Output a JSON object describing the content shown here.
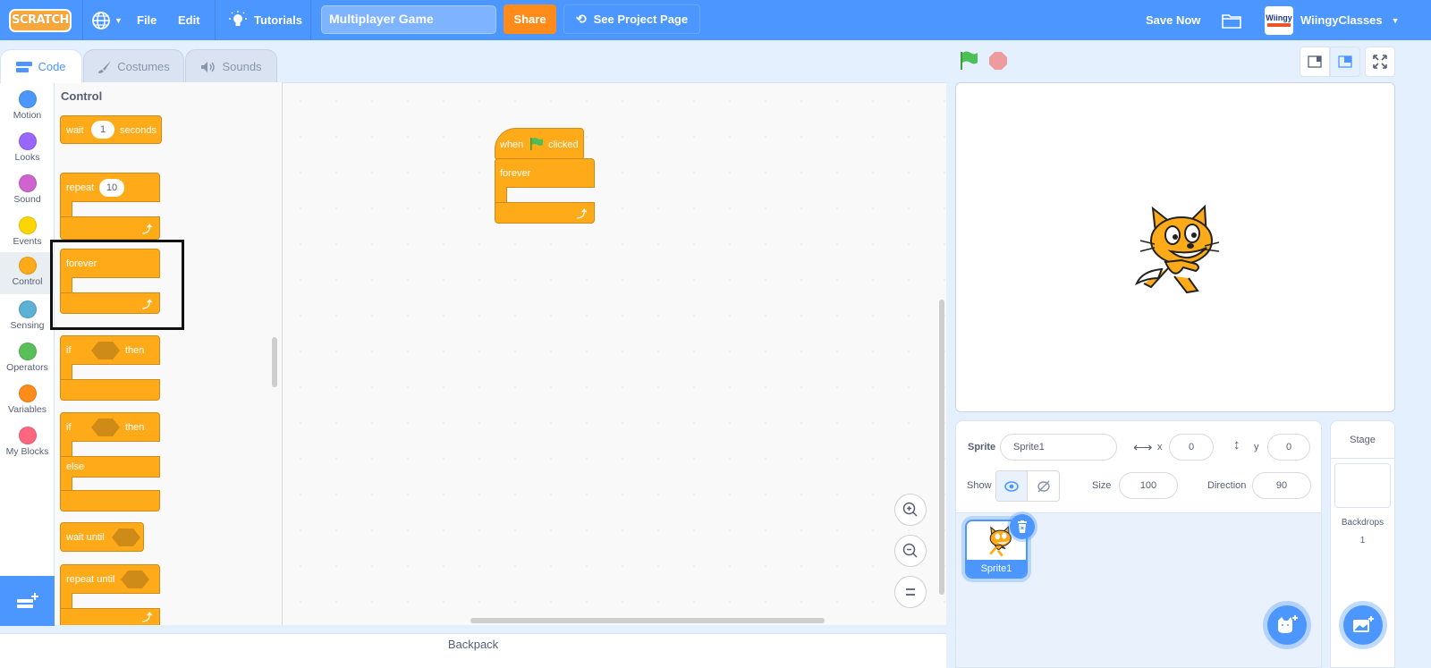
{
  "menubar": {
    "logo": "SCRATCH",
    "file": "File",
    "edit": "Edit",
    "tutorials": "Tutorials",
    "project_title": "Multiplayer Game",
    "share": "Share",
    "see_project_page": "See Project Page",
    "save_now": "Save Now",
    "username": "WiingyClasses",
    "avatar_text": "Wiingy"
  },
  "tabs": [
    {
      "label": "Code",
      "icon": "code-icon",
      "active": true
    },
    {
      "label": "Costumes",
      "icon": "brush-icon",
      "active": false
    },
    {
      "label": "Sounds",
      "icon": "speaker-icon",
      "active": false
    }
  ],
  "categories": [
    {
      "label": "Motion",
      "color": "#4c97ff"
    },
    {
      "label": "Looks",
      "color": "#9966ff"
    },
    {
      "label": "Sound",
      "color": "#cf63cf"
    },
    {
      "label": "Events",
      "color": "#ffd500"
    },
    {
      "label": "Control",
      "color": "#ffab19",
      "selected": true
    },
    {
      "label": "Sensing",
      "color": "#5cb1d6"
    },
    {
      "label": "Operators",
      "color": "#59c059"
    },
    {
      "label": "Variables",
      "color": "#ff8c1a"
    },
    {
      "label": "My Blocks",
      "color": "#ff6680"
    }
  ],
  "palette": {
    "heading": "Control",
    "blocks": {
      "wait": {
        "label": "wait",
        "value": "1",
        "suffix": "seconds"
      },
      "repeat": {
        "label": "repeat",
        "value": "10"
      },
      "forever": {
        "label": "forever"
      },
      "if_then": {
        "label": "if",
        "suffix": "then"
      },
      "if_else": {
        "label": "if",
        "suffix": "then",
        "else": "else"
      },
      "wait_until": {
        "label": "wait until"
      },
      "repeat_until": {
        "label": "repeat until"
      }
    }
  },
  "workspace": {
    "script": {
      "hat": {
        "prefix": "when",
        "suffix": "clicked"
      },
      "forever": "forever"
    }
  },
  "backpack": "Backpack",
  "sprite_info": {
    "sprite_label": "Sprite",
    "sprite_name": "Sprite1",
    "x_label": "x",
    "x_value": "0",
    "y_label": "y",
    "y_value": "0",
    "show_label": "Show",
    "size_label": "Size",
    "size_value": "100",
    "direction_label": "Direction",
    "direction_value": "90"
  },
  "sprites": [
    {
      "name": "Sprite1",
      "selected": true
    }
  ],
  "stage_selector": {
    "title": "Stage",
    "backdrops_label": "Backdrops",
    "backdrops_count": "1"
  },
  "colors": {
    "brand": "#4c97ff",
    "control": "#ffab19",
    "share": "#ff8c1a"
  }
}
